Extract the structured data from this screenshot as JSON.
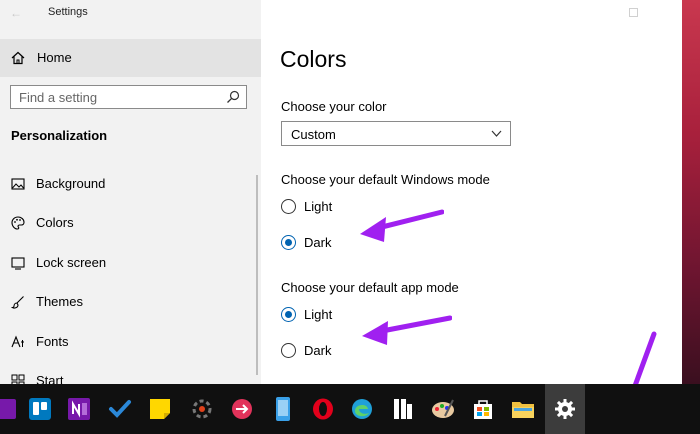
{
  "window": {
    "title": "Settings"
  },
  "sidebar": {
    "home_label": "Home",
    "search_placeholder": "Find a setting",
    "section_title": "Personalization",
    "items": [
      {
        "label": "Background",
        "icon": "image-icon"
      },
      {
        "label": "Colors",
        "icon": "palette-icon"
      },
      {
        "label": "Lock screen",
        "icon": "lock-screen-icon"
      },
      {
        "label": "Themes",
        "icon": "brush-icon"
      },
      {
        "label": "Fonts",
        "icon": "fonts-icon"
      },
      {
        "label": "Start",
        "icon": "start-icon"
      }
    ]
  },
  "main": {
    "title": "Colors",
    "choose_color_label": "Choose your color",
    "color_dropdown_value": "Custom",
    "windows_mode": {
      "label": "Choose your default Windows mode",
      "options": [
        "Light",
        "Dark"
      ],
      "selected": "Dark"
    },
    "app_mode": {
      "label": "Choose your default app mode",
      "options": [
        "Light",
        "Dark"
      ],
      "selected": "Light"
    }
  },
  "annotations": {
    "arrow_color": "#a020f0"
  },
  "taskbar": {
    "icons": [
      "onenote-partial-icon",
      "trello-icon",
      "onenote-icon",
      "todo-icon",
      "sticky-notes-icon",
      "loading-ring-icon",
      "pink-messaging-icon",
      "phone-icon",
      "opera-icon",
      "edge-icon",
      "bookmark-app-icon",
      "paint-icon",
      "store-icon",
      "file-explorer-icon",
      "settings-icon"
    ],
    "active": "settings-icon"
  },
  "colors": {
    "accent": "#0063b1",
    "sidebar_bg": "#f2f2f2",
    "taskbar_bg": "#101010"
  }
}
